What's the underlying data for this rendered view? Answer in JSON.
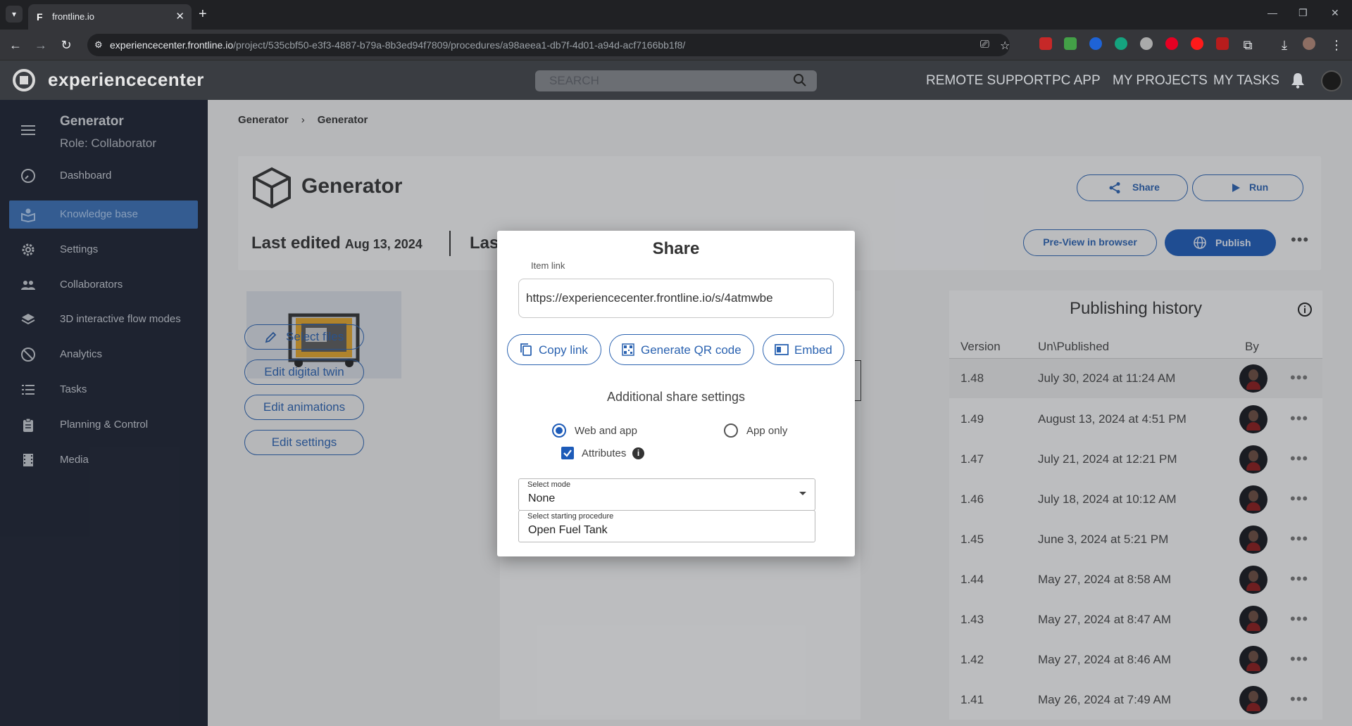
{
  "browser": {
    "tab_title": "frontline.io",
    "url_host": "experiencecenter.frontline.io",
    "url_path": "/project/535cbf50-e3f3-4887-b79a-8b3ed94f7809/procedures/a98aeea1-db7f-4d01-a94d-acf7166bb1f8/"
  },
  "header": {
    "brand": "experiencecenter",
    "search_placeholder": "SEARCH",
    "nav": [
      "REMOTE SUPPORT",
      "PC APP",
      "MY PROJECTS",
      "MY TASKS"
    ]
  },
  "sidebar": {
    "project": "Generator",
    "role": "Role: Collaborator",
    "items": [
      {
        "label": "Dashboard",
        "icon": "dashboard-icon"
      },
      {
        "label": "Knowledge base",
        "icon": "knowledge-base-icon",
        "active": true
      },
      {
        "label": "Settings",
        "icon": "gear-icon"
      },
      {
        "label": "Collaborators",
        "icon": "people-icon"
      },
      {
        "label": "3D interactive flow modes",
        "icon": "layers-icon"
      },
      {
        "label": "Analytics",
        "icon": "analytics-icon"
      },
      {
        "label": "Tasks",
        "icon": "list-icon"
      },
      {
        "label": "Planning & Control",
        "icon": "clipboard-icon"
      },
      {
        "label": "Media",
        "icon": "film-icon"
      }
    ]
  },
  "main": {
    "breadcrumb": [
      "Generator",
      "Generator"
    ],
    "title": "Generator",
    "last_edited_label": "Last edited",
    "last_edited_date": "Aug 13, 2024",
    "last_cut": "Las",
    "share_label": "Share",
    "run_label": "Run",
    "preview_label": "Pre-View in browser",
    "publish_label": "Publish",
    "side_buttons": [
      "Select files",
      "Edit digital twin",
      "Edit animations",
      "Edit settings"
    ]
  },
  "history": {
    "title": "Publishing history",
    "columns": [
      "Version",
      "Un\\Published",
      "By"
    ],
    "rows": [
      {
        "version": "1.48",
        "date": "July 30, 2024 at 11:24 AM"
      },
      {
        "version": "1.49",
        "date": "August 13, 2024 at 4:51 PM"
      },
      {
        "version": "1.47",
        "date": "July 21, 2024 at 12:21 PM"
      },
      {
        "version": "1.46",
        "date": "July 18, 2024 at 10:12 AM"
      },
      {
        "version": "1.45",
        "date": "June 3, 2024 at 5:21 PM"
      },
      {
        "version": "1.44",
        "date": "May 27, 2024 at 8:58 AM"
      },
      {
        "version": "1.43",
        "date": "May 27, 2024 at 8:47 AM"
      },
      {
        "version": "1.42",
        "date": "May 27, 2024 at 8:46 AM"
      },
      {
        "version": "1.41",
        "date": "May 26, 2024 at 7:49 AM"
      }
    ]
  },
  "modal": {
    "title": "Share",
    "item_link_label": "Item link",
    "item_link": "https://experiencecenter.frontline.io/s/4atmwbe",
    "copy_label": "Copy link",
    "qr_label": "Generate QR code",
    "embed_label": "Embed",
    "additional": "Additional share settings",
    "radio_web": "Web and app",
    "radio_app": "App only",
    "attributes": "Attributes",
    "info_glyph": "i",
    "mode_label": "Select mode",
    "mode_value": "None",
    "proc_label": "Select starting procedure",
    "proc_value": "Open Fuel Tank"
  },
  "colors": {
    "accent": "#1d5bb8",
    "sidebar_bg": "#1b2130",
    "header_bg": "#3a3d42"
  }
}
